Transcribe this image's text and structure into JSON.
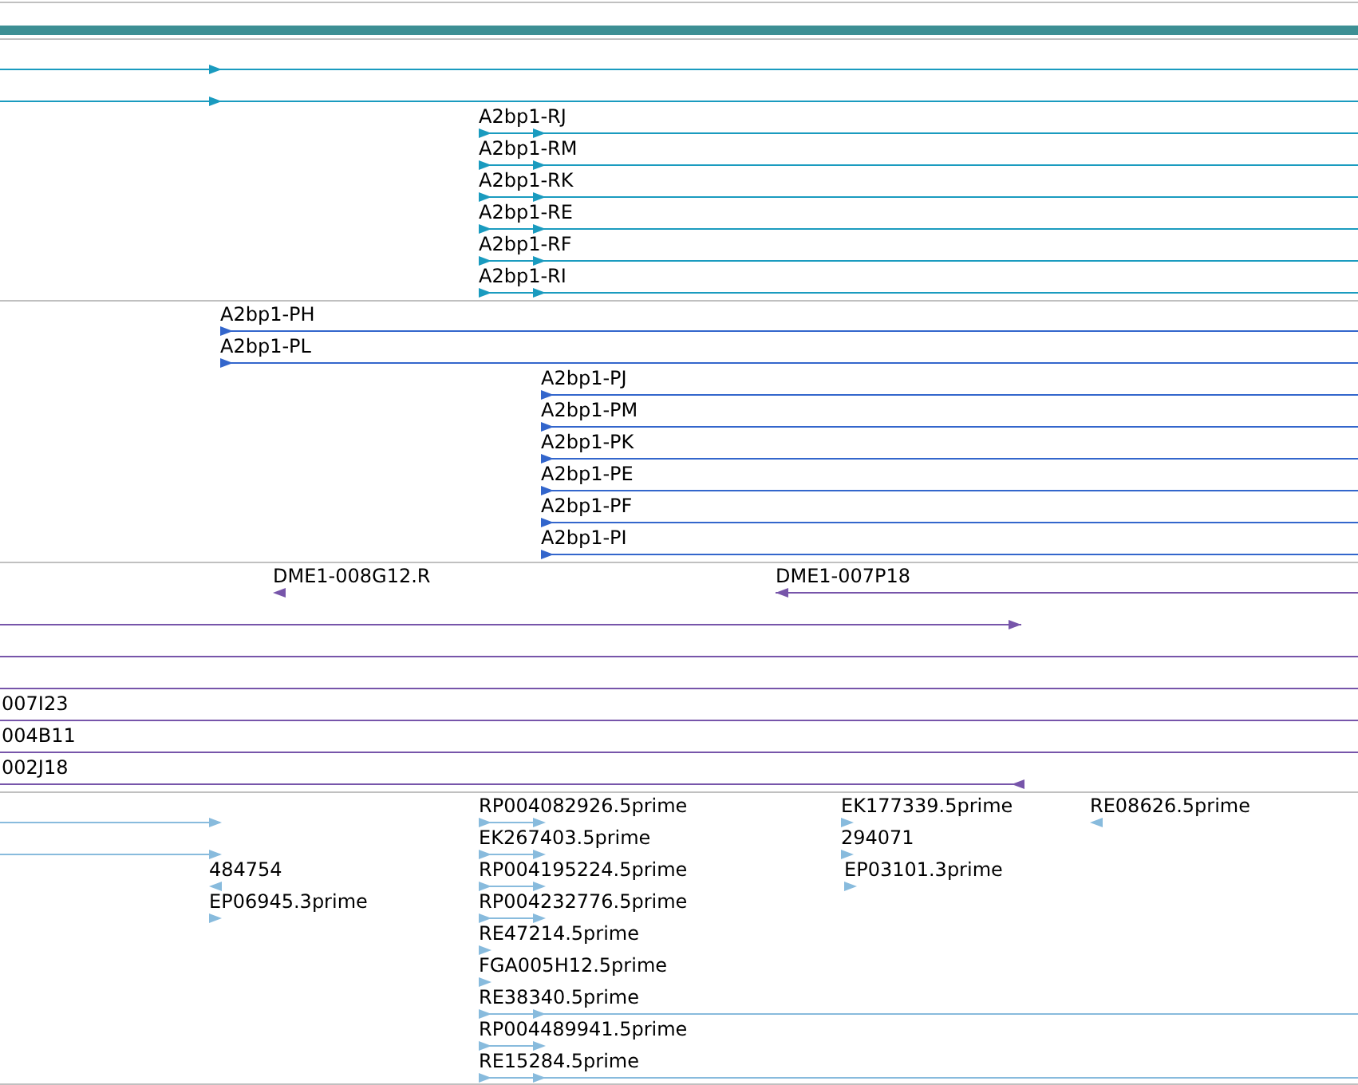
{
  "tracks": [
    {
      "color": "#1a9bbf",
      "features": [
        {
          "kind": "forward"
        },
        {
          "kind": "forward"
        },
        {
          "label": "A2bp1-RJ",
          "kind": "forward"
        },
        {
          "label": "A2bp1-RM",
          "kind": "forward"
        },
        {
          "label": "A2bp1-RK",
          "kind": "forward"
        },
        {
          "label": "A2bp1-RE",
          "kind": "forward"
        },
        {
          "label": "A2bp1-RF",
          "kind": "forward"
        },
        {
          "label": "A2bp1-RI",
          "kind": "forward"
        }
      ]
    },
    {
      "color": "#3366cc",
      "features": [
        {
          "label": "A2bp1-PH",
          "kind": "forward"
        },
        {
          "label": "A2bp1-PL",
          "kind": "forward"
        },
        {
          "label": "A2bp1-PJ",
          "kind": "forward"
        },
        {
          "label": "A2bp1-PM",
          "kind": "forward"
        },
        {
          "label": "A2bp1-PK",
          "kind": "forward"
        },
        {
          "label": "A2bp1-PE",
          "kind": "forward"
        },
        {
          "label": "A2bp1-PF",
          "kind": "forward"
        },
        {
          "label": "A2bp1-PI",
          "kind": "forward"
        }
      ]
    },
    {
      "color": "#7755aa",
      "features": [
        {
          "label": "DME1-008G12.R",
          "kind": "reverse"
        },
        {
          "label": "DME1-007P18",
          "kind": "reverse"
        },
        {
          "kind": "forward"
        },
        {
          "kind": "plain"
        },
        {
          "kind": "plain"
        },
        {
          "label": "007I23",
          "kind": "plain"
        },
        {
          "label": "004B11",
          "kind": "plain"
        },
        {
          "label": "002J18",
          "kind": "reverse"
        }
      ]
    },
    {
      "color": "#88bbdd",
      "features": [
        {
          "kind": "forward"
        },
        {
          "kind": "forward"
        },
        {
          "label": "484754",
          "kind": "reverse"
        },
        {
          "label": "EP06945.3prime",
          "kind": "forward"
        },
        {
          "label": "RP004082926.5prime",
          "kind": "forward"
        },
        {
          "label": "EK267403.5prime",
          "kind": "forward"
        },
        {
          "label": "RP004195224.5prime",
          "kind": "forward"
        },
        {
          "label": "RP004232776.5prime",
          "kind": "forward"
        },
        {
          "label": "RE47214.5prime",
          "kind": "forward"
        },
        {
          "label": "FGA005H12.5prime",
          "kind": "forward"
        },
        {
          "label": "RE38340.5prime",
          "kind": "forward"
        },
        {
          "label": "RP004489941.5prime",
          "kind": "forward"
        },
        {
          "label": "RE15284.5prime",
          "kind": "forward"
        },
        {
          "label": "EK177339.5prime",
          "kind": "forward"
        },
        {
          "label": "294071",
          "kind": "forward"
        },
        {
          "label": "EP03101.3prime",
          "kind": "forward"
        },
        {
          "label": "RE08626.5prime",
          "kind": "reverse"
        }
      ]
    }
  ]
}
